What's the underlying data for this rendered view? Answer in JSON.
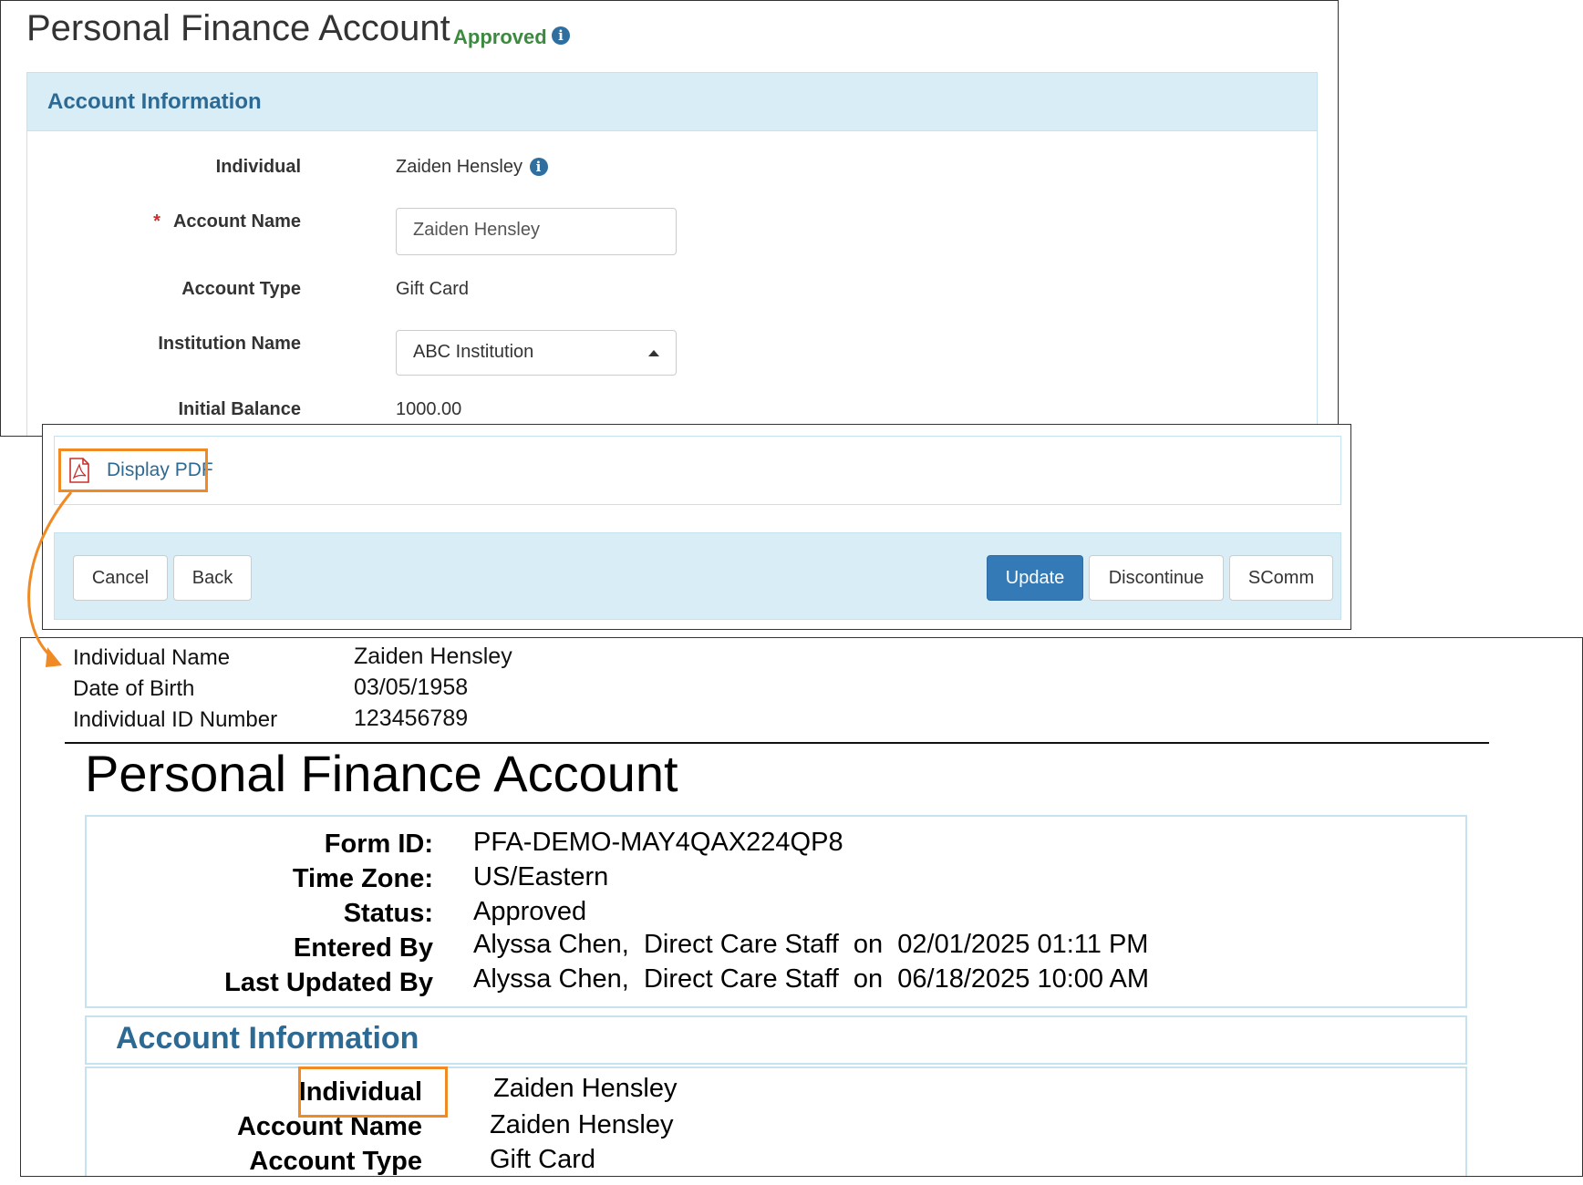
{
  "form": {
    "title": "Personal Finance Account",
    "status": "Approved",
    "section_title": "Account Information",
    "fields": {
      "individual_label": "Individual",
      "individual_value": "Zaiden Hensley",
      "account_name_label": "Account Name",
      "account_name_required": "*",
      "account_name_value": "Zaiden Hensley",
      "account_type_label": "Account Type",
      "account_type_value": "Gift Card",
      "institution_label": "Institution Name",
      "institution_value": "ABC Institution",
      "initial_balance_label": "Initial Balance",
      "initial_balance_value": "1000.00"
    }
  },
  "actions": {
    "display_pdf_label": "Display PDF",
    "cancel_label": "Cancel",
    "back_label": "Back",
    "update_label": "Update",
    "discontinue_label": "Discontinue",
    "scomm_label": "SComm"
  },
  "pdf": {
    "demographics": {
      "name_label": "Individual Name",
      "name_value": "Zaiden Hensley",
      "dob_label": "Date of Birth",
      "dob_value": "03/05/1958",
      "id_label": "Individual ID Number",
      "id_value": "123456789"
    },
    "title": "Personal Finance Account",
    "meta": {
      "form_id_label": "Form ID:",
      "form_id_value": "PFA-DEMO-MAY4QAX224QP8",
      "time_zone_label": "Time Zone:",
      "time_zone_value": "US/Eastern",
      "status_label": "Status:",
      "status_value": "Approved",
      "entered_by_label": "Entered By",
      "entered_by_value": "Alyssa Chen,  Direct Care Staff  on  02/01/2025 01:11 PM",
      "last_updated_label": "Last Updated By",
      "last_updated_value": "Alyssa Chen,  Direct Care Staff  on  06/18/2025 10:00 AM"
    },
    "section_title": "Account Information",
    "fields": {
      "individual_label": "Individual",
      "individual_value": "Zaiden Hensley",
      "account_name_label": "Account Name",
      "account_name_value": "Zaiden Hensley",
      "account_type_label": "Account Type",
      "account_type_value": "Gift Card"
    }
  },
  "colors": {
    "accent_blue": "#2d6a93",
    "primary_button": "#337ab7",
    "section_background": "#d9edf7",
    "approved_green": "#3c8a3f",
    "highlight_orange": "#f08a24",
    "required_red": "#c9302c"
  },
  "icons": {
    "status_info": "info-icon",
    "individual_info": "info-icon",
    "pdf": "pdf-file-icon",
    "institution_dropdown": "caret-up-icon",
    "callout": "curved-arrow-icon"
  }
}
